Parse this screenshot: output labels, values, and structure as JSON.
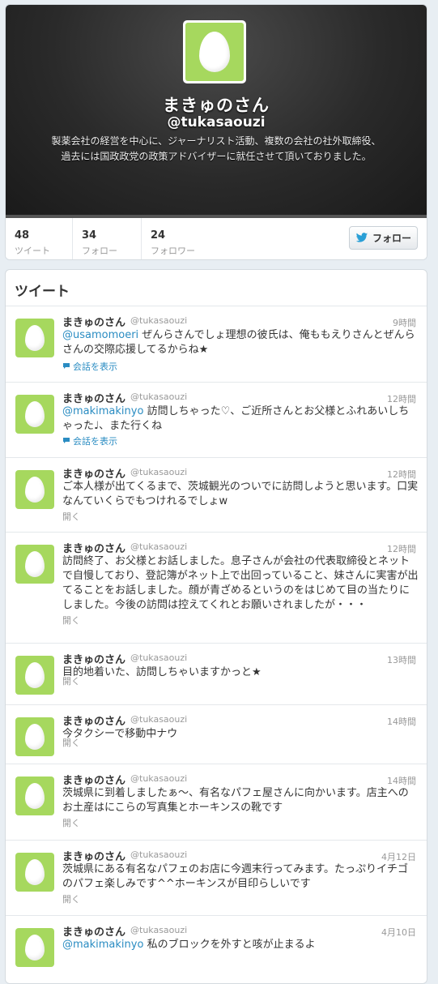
{
  "profile": {
    "name": "まきゅのさん",
    "handle": "@tukasaouzi",
    "bio_line1": "製薬会社の経営を中心に、ジャーナリスト活動、複数の会社の社外取締役、",
    "bio_line2": "過去には国政政党の政策アドバイザーに就任させて頂いておりました。",
    "accent_color": "#a6d85e"
  },
  "stats": [
    {
      "value": "48",
      "label": "ツイート"
    },
    {
      "value": "34",
      "label": "フォロー"
    },
    {
      "value": "24",
      "label": "フォロワー"
    }
  ],
  "follow_button": {
    "label": "フォロー",
    "icon": "twitter-bird-icon"
  },
  "tweets_header": "ツイート",
  "tweets": [
    {
      "name": "まきゅのさん",
      "handle": "@tukasaouzi",
      "time": "9時間",
      "mention": "@usamomoeri",
      "text": " ぜんらさんでしょ理想の彼氏は、俺ももえりさんとぜんらさんの交際応援してるからね★",
      "action": "会話を表示",
      "action_type": "conversation"
    },
    {
      "name": "まきゅのさん",
      "handle": "@tukasaouzi",
      "time": "12時間",
      "mention": "@makimakinyo",
      "text": " 訪問しちゃった♡、ご近所さんとお父様とふれあいしちゃった♩、また行くね",
      "action": "会話を表示",
      "action_type": "conversation"
    },
    {
      "name": "まきゅのさん",
      "handle": "@tukasaouzi",
      "time": "12時間",
      "mention": "",
      "text": "ご本人様が出てくるまで、茨城観光のついでに訪問しようと思います。口実なんていくらでもつけれるでしょw",
      "action": "開く",
      "action_type": "open"
    },
    {
      "name": "まきゅのさん",
      "handle": "@tukasaouzi",
      "time": "12時間",
      "mention": "",
      "text": "訪問終了、お父様とお話しました。息子さんが会社の代表取締役とネットで自慢しており、登記簿がネット上で出回っていること、妹さんに実害が出てることをお話しました。顔が青ざめるというのをはじめて目の当たりにしました。今後の訪問は控えてくれとお願いされましたが・・・",
      "action": "開く",
      "action_type": "open"
    },
    {
      "name": "まきゅのさん",
      "handle": "@tukasaouzi",
      "time": "13時間",
      "mention": "",
      "text": "目的地着いた、訪問しちゃいますかっと★",
      "action": "開く",
      "action_type": "open"
    },
    {
      "name": "まきゅのさん",
      "handle": "@tukasaouzi",
      "time": "14時間",
      "mention": "",
      "text": "今タクシーで移動中ナウ",
      "action": "開く",
      "action_type": "open"
    },
    {
      "name": "まきゅのさん",
      "handle": "@tukasaouzi",
      "time": "14時間",
      "mention": "",
      "text": "茨城県に到着しましたぁ〜、有名なパフェ屋さんに向かいます。店主へのお土産はにこらの写真集とホーキンスの靴です",
      "action": "開く",
      "action_type": "open"
    },
    {
      "name": "まきゅのさん",
      "handle": "@tukasaouzi",
      "time": "4月12日",
      "mention": "",
      "text": "茨城県にある有名なパフェのお店に今週末行ってみます。たっぷりイチゴのパフェ楽しみです^^ホーキンスが目印らしいです",
      "action": "開く",
      "action_type": "open"
    },
    {
      "name": "まきゅのさん",
      "handle": "@tukasaouzi",
      "time": "4月10日",
      "mention": "@makimakinyo",
      "text": " 私のブロックを外すと咳が止まるよ",
      "action": "",
      "action_type": "none"
    }
  ]
}
